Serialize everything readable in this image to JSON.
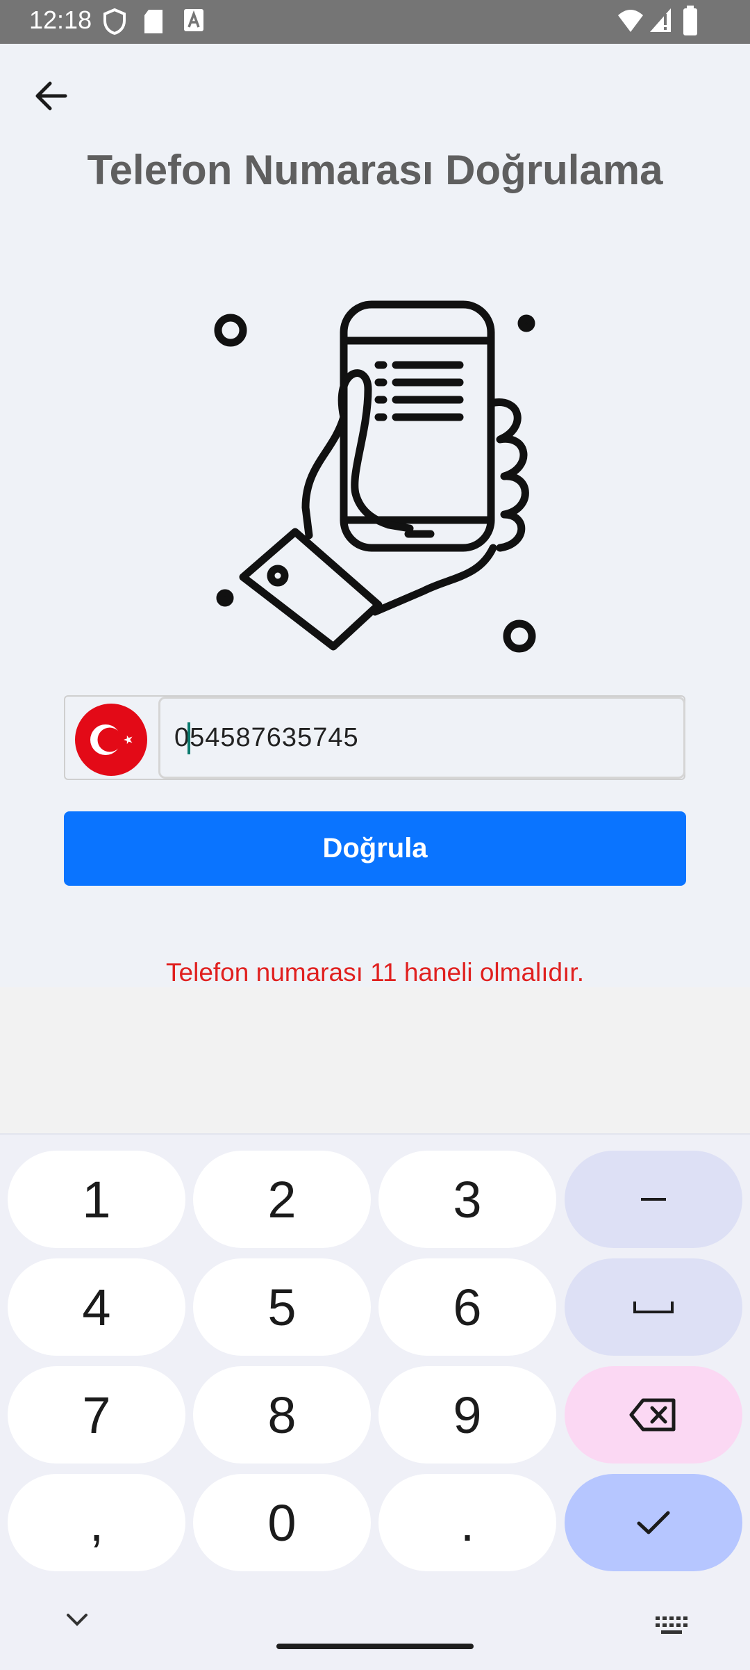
{
  "status_bar": {
    "time": "12:18"
  },
  "page": {
    "title": "Telefon Numarası Doğrulama",
    "phone_value": "054587635745",
    "verify_label": "Doğrula",
    "error_message": "Telefon numarası 11 haneli olmalıdır.",
    "flag_icon": "turkey-flag-icon"
  },
  "keyboard": {
    "rows": [
      [
        "1",
        "2",
        "3",
        "–"
      ],
      [
        "4",
        "5",
        "6",
        "space"
      ],
      [
        "7",
        "8",
        "9",
        "backspace"
      ],
      [
        ",",
        "0",
        ".",
        "done"
      ]
    ]
  },
  "colors": {
    "accent": "#0a74ff",
    "error": "#e0201f",
    "flag_red": "#e30a17"
  }
}
